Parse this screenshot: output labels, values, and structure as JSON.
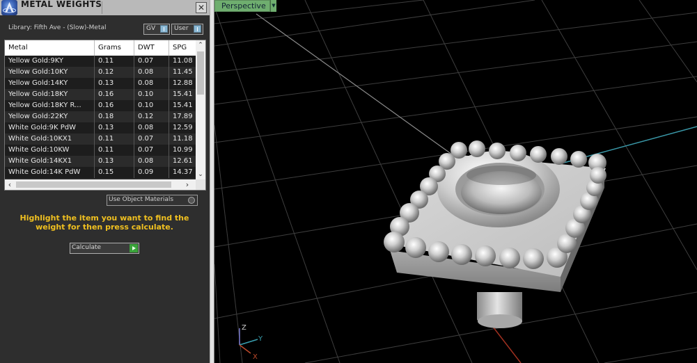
{
  "panel": {
    "title": "METAL WEIGHTS",
    "close_glyph": "✕",
    "library_label": "Library: Fifth Ave - (Slow)-Metal",
    "toggles": {
      "gv": "GV",
      "user": "User"
    },
    "table": {
      "columns": [
        "Metal",
        "Grams",
        "DWT",
        "SPG"
      ],
      "rows": [
        [
          "Yellow Gold:9KY",
          "0.11",
          "0.07",
          "11.08"
        ],
        [
          "Yellow Gold:10KY",
          "0.12",
          "0.08",
          "11.45"
        ],
        [
          "Yellow Gold:14KY",
          "0.13",
          "0.08",
          "12.88"
        ],
        [
          "Yellow Gold:18KY",
          "0.16",
          "0.10",
          "15.41"
        ],
        [
          "Yellow Gold:18KY R...",
          "0.16",
          "0.10",
          "15.41"
        ],
        [
          "Yellow Gold:22KY",
          "0.18",
          "0.12",
          "17.89"
        ],
        [
          "White Gold:9K PdW",
          "0.13",
          "0.08",
          "12.59"
        ],
        [
          "White Gold:10KX1",
          "0.11",
          "0.07",
          "11.18"
        ],
        [
          "White Gold:10KW",
          "0.11",
          "0.07",
          "10.99"
        ],
        [
          "White Gold:14KX1",
          "0.13",
          "0.08",
          "12.61"
        ],
        [
          "White Gold:14K PdW",
          "0.15",
          "0.09",
          "14.37"
        ]
      ]
    },
    "use_object_materials": "Use Object Materials",
    "instruction": "Highlight the item you want to find the weight for then press calculate.",
    "calculate_label": "Calculate",
    "instruction_color": "#f0c020"
  },
  "viewport": {
    "view_name": "Perspective",
    "axis": {
      "z": "Z",
      "y": "Y",
      "x": "X"
    },
    "accent_color": "#6fae6f"
  },
  "icons": {
    "logo": "app-logo-icon",
    "close": "close-icon",
    "scroll_up": "arrow-up-icon",
    "scroll_down": "arrow-down-icon",
    "scroll_left": "arrow-left-icon",
    "scroll_right": "arrow-right-icon",
    "calculate": "play-icon",
    "view_menu": "dropdown-icon"
  }
}
